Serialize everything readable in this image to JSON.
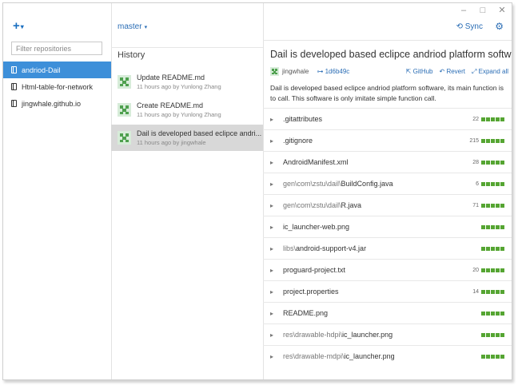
{
  "window": {
    "minimize": "–",
    "maximize": "□",
    "close": "✕"
  },
  "sidebar": {
    "add_label": "+",
    "add_caret": "▾",
    "filter_placeholder": "Filter repositories",
    "repos": [
      {
        "label": "andriod-Dail",
        "active": true
      },
      {
        "label": "Html-table-for-network",
        "active": false
      },
      {
        "label": "jingwhale.github.io",
        "active": false
      }
    ]
  },
  "middle": {
    "branch": "master",
    "branch_caret": "▾",
    "history_title": "History",
    "commits": [
      {
        "message": "Update README.md",
        "meta": "11 hours ago by Yunlong Zhang"
      },
      {
        "message": "Create README.md",
        "meta": "11 hours ago by Yunlong Zhang"
      },
      {
        "message": "Dail is developed based eclipce andri...",
        "meta": "11 hours ago by jingwhale"
      }
    ]
  },
  "detail": {
    "sync_label": "Sync",
    "sync_icon": "⟲",
    "gear_icon": "⚙",
    "title": "Dail is developed based eclipce andriod platform software",
    "author": "jingwhale",
    "sha": "1d6b49c",
    "sha_icon": "⊶",
    "actions": [
      {
        "icon": "⇱",
        "label": "GitHub"
      },
      {
        "icon": "↶",
        "label": "Revert"
      },
      {
        "icon": "⤢",
        "label": "Expand all"
      }
    ],
    "description": "Dail is developed based eclipce andriod platform software, its main function is to call. This software is only imitate simple function call.",
    "files": [
      {
        "dir": "",
        "name": ".gitattributes",
        "count": "22"
      },
      {
        "dir": "",
        "name": ".gitignore",
        "count": "215"
      },
      {
        "dir": "",
        "name": "AndroidManifest.xml",
        "count": "28"
      },
      {
        "dir": "gen\\com\\zstu\\dail\\",
        "name": "BuildConfig.java",
        "count": "6"
      },
      {
        "dir": "gen\\com\\zstu\\dail\\",
        "name": "R.java",
        "count": "71"
      },
      {
        "dir": "",
        "name": "ic_launcher-web.png",
        "count": ""
      },
      {
        "dir": "libs\\",
        "name": "android-support-v4.jar",
        "count": ""
      },
      {
        "dir": "",
        "name": "proguard-project.txt",
        "count": "20"
      },
      {
        "dir": "",
        "name": "project.properties",
        "count": "14"
      },
      {
        "dir": "",
        "name": "README.png",
        "count": ""
      },
      {
        "dir": "res\\drawable-hdpi\\",
        "name": "ic_launcher.png",
        "count": ""
      },
      {
        "dir": "res\\drawable-mdpi\\",
        "name": "ic_launcher.png",
        "count": ""
      }
    ],
    "bar_color": "#55a532"
  }
}
